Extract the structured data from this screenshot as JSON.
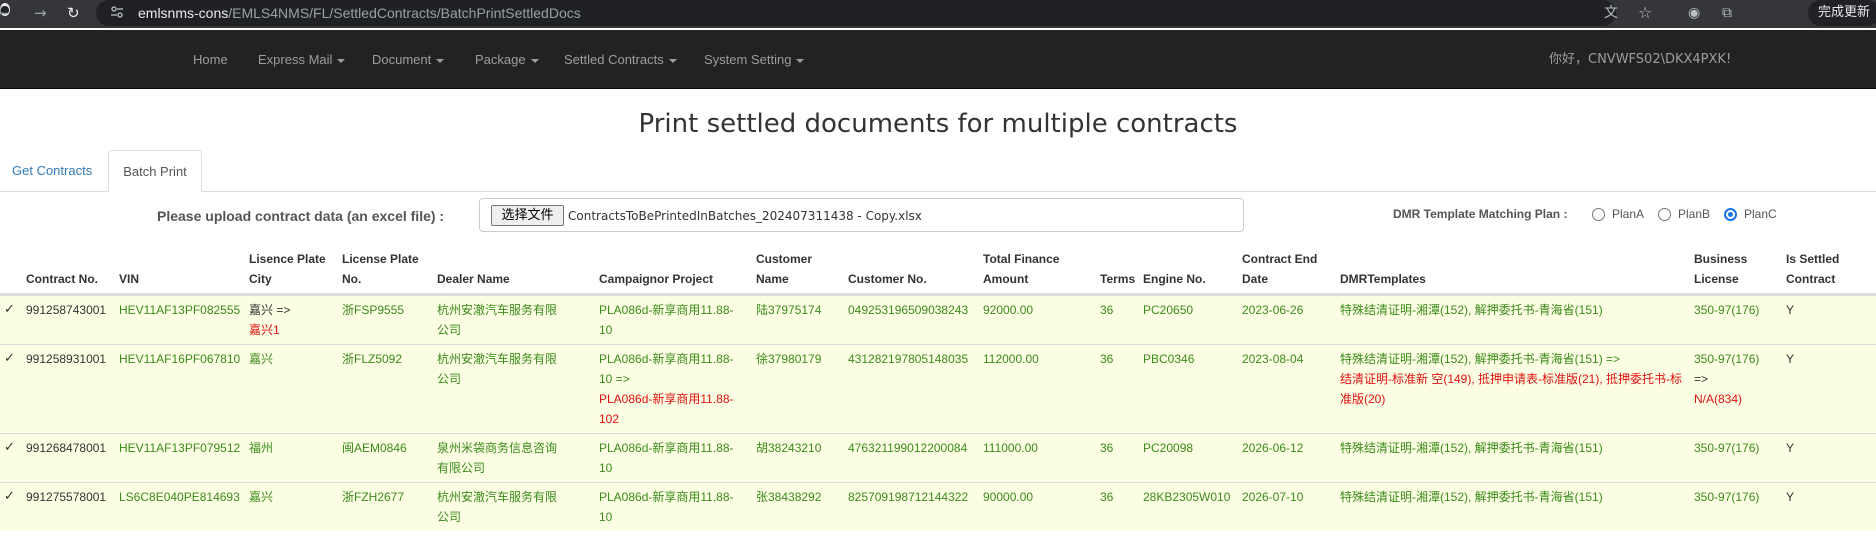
{
  "browser": {
    "url_host": "emlsnms-cons",
    "url_path": "/EMLS4NMS/FL/SettledContracts/BatchPrintSettledDocs",
    "update_label": "完成更新",
    "translate_icon": "文"
  },
  "navbar": {
    "home": "Home",
    "express_mail": "Express Mail",
    "document": "Document",
    "package": "Package",
    "settled_contracts": "Settled Contracts",
    "system_setting": "System Setting",
    "greeting": "你好，CNVWFS02\\DKX4PXK!"
  },
  "page": {
    "title": "Print settled documents for multiple contracts"
  },
  "tabs": {
    "get_contracts": "Get Contracts",
    "batch_print": "Batch Print"
  },
  "upload": {
    "label": "Please upload contract data (an excel file) :",
    "button": "选择文件",
    "file_name": "ContractsToBePrintedInBatches_202407311438 - Copy.xlsx"
  },
  "plan": {
    "label": "DMR Template Matching Plan :",
    "options": [
      "PlanA",
      "PlanB",
      "PlanC"
    ],
    "selected": "PlanC"
  },
  "table": {
    "headers": {
      "contract_no": "Contract No.",
      "vin": "VIN",
      "city_1": "Lisence Plate",
      "city_2": "City",
      "plate_1": "License Plate",
      "plate_2": "No.",
      "dealer": "Dealer Name",
      "campaign": "Campaignor Project",
      "customer_1": "Customer",
      "customer_2": "Name",
      "customer_no": "Customer No.",
      "finance_1": "Total Finance",
      "finance_2": "Amount",
      "terms": "Terms",
      "engine": "Engine No.",
      "end_1": "Contract End",
      "end_2": "Date",
      "dmr": "DMRTemplates",
      "license_1": "Business",
      "license_2": "License",
      "settled_1": "Is Settled",
      "settled_2": "Contract"
    },
    "rows": [
      {
        "check": "✓",
        "contract_no": "991258743001",
        "vin": "HEV11AF13PF082555",
        "city_a": "嘉兴 =>",
        "city_b": "嘉兴1",
        "plate": "浙FSP9555",
        "dealer_1": "杭州安澈汽车服务有限",
        "dealer_2": "公司",
        "campaign_1": "PLA086d-新享商用11.88-",
        "campaign_2": "10",
        "customer_name": "陆37975174",
        "customer_no": "049253196509038243",
        "finance": "92000.00",
        "terms": "36",
        "engine": "PC20650",
        "end_date": "2023-06-26",
        "dmr": "特殊结清证明-湘潭(152), 解押委托书-青海省(151)",
        "license": "350-97(176)",
        "settled": "Y"
      },
      {
        "check": "✓",
        "contract_no": "991258931001",
        "vin": "HEV11AF16PF067810",
        "city_a": "嘉兴",
        "plate": "浙FLZ5092",
        "dealer_1": "杭州安澈汽车服务有限",
        "dealer_2": "公司",
        "campaign_1": "PLA086d-新享商用11.88-",
        "campaign_2": "10 =>",
        "campaign_3": "PLA086d-新享商用11.88-",
        "campaign_4": "102",
        "customer_name": "徐37980179",
        "customer_no": "431282197805148035",
        "finance": "112000.00",
        "terms": "36",
        "engine": "PBC0346",
        "end_date": "2023-08-04",
        "dmr": "特殊结清证明-湘潭(152), 解押委托书-青海省(151) =>",
        "dmr_new": "结清证明-标准新 空(149), 抵押申请表-标准版(21), 抵押委托书-标准版(20)",
        "license": "350-97(176)",
        "license_arrow": "=>",
        "license_new": "N/A(834)",
        "settled": "Y"
      },
      {
        "check": "✓",
        "contract_no": "991268478001",
        "vin": "HEV11AF13PF079512",
        "city_a": "福州",
        "plate": "闽AEM0846",
        "dealer_1": "泉州米袋商务信息咨询",
        "dealer_2": "有限公司",
        "campaign_1": "PLA086d-新享商用11.88-",
        "campaign_2": "10",
        "customer_name": "胡38243210",
        "customer_no": "476321199012200084",
        "finance": "111000.00",
        "terms": "36",
        "engine": "PC20098",
        "end_date": "2026-06-12",
        "dmr": "特殊结清证明-湘潭(152), 解押委托书-青海省(151)",
        "license": "350-97(176)",
        "settled": "Y"
      },
      {
        "check": "✓",
        "contract_no": "991275578001",
        "vin": "LS6C8E040PE814693",
        "city_a": "嘉兴",
        "plate": "浙FZH2677",
        "dealer_1": "杭州安澈汽车服务有限",
        "dealer_2": "公司",
        "campaign_1": "PLA086d-新享商用11.88-",
        "campaign_2": "10",
        "customer_name": "张38438292",
        "customer_no": "825709198712144322",
        "finance": "90000.00",
        "terms": "36",
        "engine": "28KB2305W010",
        "end_date": "2026-07-10",
        "dmr": "特殊结清证明-湘潭(152), 解押委托书-青海省(151)",
        "license": "350-97(176)",
        "settled": "Y"
      }
    ]
  },
  "colors": {
    "navbar_bg": "#222222",
    "row_bg": "#fcfee3",
    "ok_text": "#3c8a1c",
    "changed_text": "#e01010",
    "link": "#337ab7"
  }
}
